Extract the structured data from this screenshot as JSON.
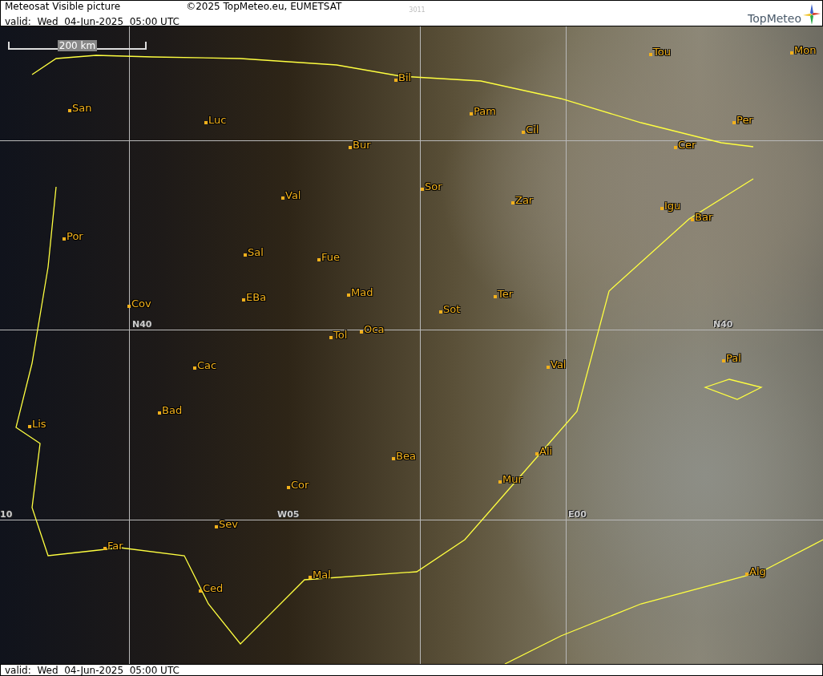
{
  "header": {
    "title": "Meteosat Visible picture",
    "copyright": "©2025 TopMeteo.eu, EUMETSAT",
    "code": "3011",
    "valid": "valid:  Wed  04-Jun-2025  05:00 UTC",
    "logo": "TopMeteo"
  },
  "map": {
    "scale": "200 km",
    "grid_labels": [
      "N40",
      "W05",
      "E00",
      "N40",
      "10"
    ],
    "cities": [
      {
        "name": "San"
      },
      {
        "name": "Luc"
      },
      {
        "name": "Bil"
      },
      {
        "name": "Pam"
      },
      {
        "name": "Cil"
      },
      {
        "name": "Tou"
      },
      {
        "name": "Mon"
      },
      {
        "name": "Per"
      },
      {
        "name": "Cer"
      },
      {
        "name": "Bur"
      },
      {
        "name": "Val"
      },
      {
        "name": "Sor"
      },
      {
        "name": "Zar"
      },
      {
        "name": "Igu"
      },
      {
        "name": "Bar"
      },
      {
        "name": "Por"
      },
      {
        "name": "Sal"
      },
      {
        "name": "Fue"
      },
      {
        "name": "Mad"
      },
      {
        "name": "EBa"
      },
      {
        "name": "Cov"
      },
      {
        "name": "Ter"
      },
      {
        "name": "Sot"
      },
      {
        "name": "Tol"
      },
      {
        "name": "Oca"
      },
      {
        "name": "Pal"
      },
      {
        "name": "Val"
      },
      {
        "name": "Cac"
      },
      {
        "name": "Bad"
      },
      {
        "name": "Lis"
      },
      {
        "name": "Ali"
      },
      {
        "name": "Bea"
      },
      {
        "name": "Mur"
      },
      {
        "name": "Cor"
      },
      {
        "name": "Sev"
      },
      {
        "name": "Far"
      },
      {
        "name": "Ced"
      },
      {
        "name": "Mal"
      },
      {
        "name": "Alg"
      }
    ]
  },
  "footer": {
    "valid": "valid:  Wed  04-Jun-2025  05:00 UTC"
  }
}
